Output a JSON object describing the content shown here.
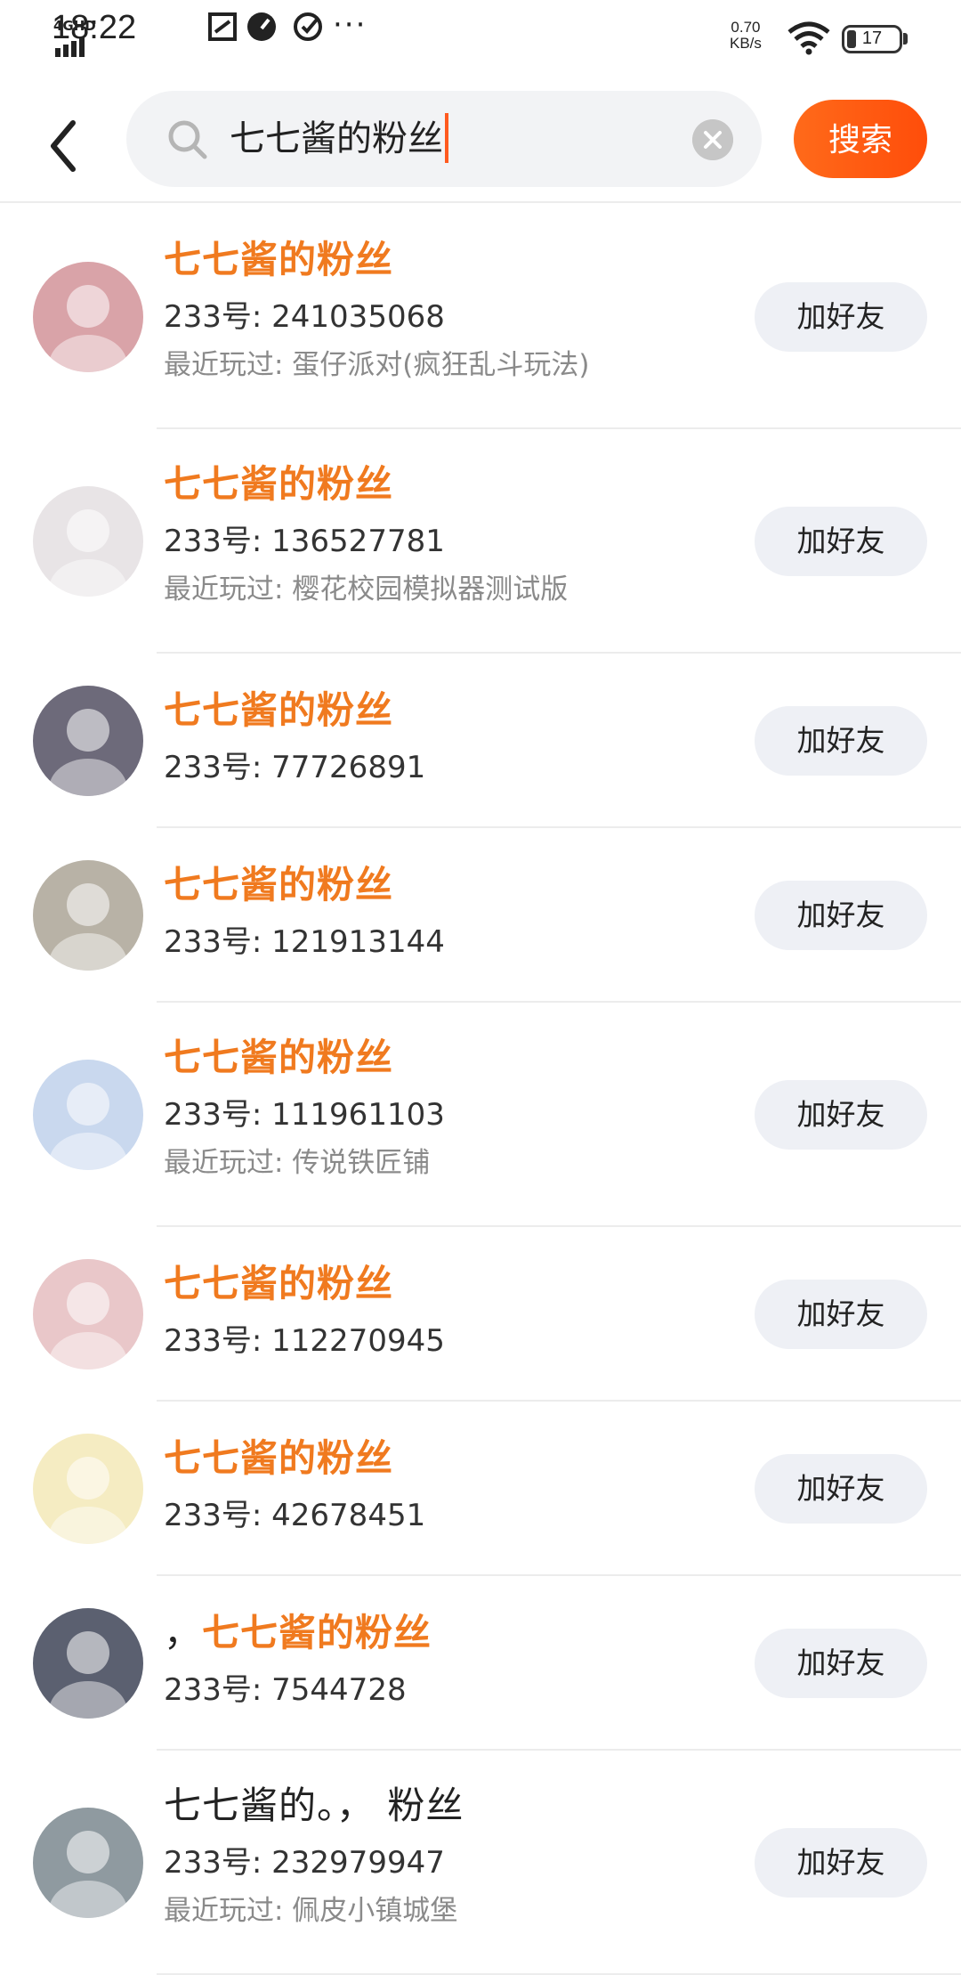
{
  "status_bar": {
    "network": "4GHD",
    "time": "18:22",
    "speed_value": "0.70",
    "speed_unit": "KB/s",
    "battery": "17",
    "battery_level": 0.17
  },
  "header": {
    "search_value": "七七酱的粉丝",
    "search_button": "搜索"
  },
  "results": [
    {
      "name_prefix": "",
      "name": "七七酱的粉丝",
      "uid": "233号: 241035068",
      "recent": "最近玩过: 蛋仔派对(疯狂乱斗玩法)",
      "button": "加好友",
      "avatar_color": "#d9a3a8"
    },
    {
      "name_prefix": "",
      "name": "七七酱的粉丝",
      "uid": "233号: 136527781",
      "recent": "最近玩过: 樱花校园模拟器测试版",
      "button": "加好友",
      "avatar_color": "#e8e4e6"
    },
    {
      "name_prefix": "",
      "name": "七七酱的粉丝",
      "uid": "233号: 77726891",
      "recent": "",
      "button": "加好友",
      "avatar_color": "#6d6a7a"
    },
    {
      "name_prefix": "",
      "name": "七七酱的粉丝",
      "uid": "233号: 121913144",
      "recent": "",
      "button": "加好友",
      "avatar_color": "#b8b2a6"
    },
    {
      "name_prefix": "",
      "name": "七七酱的粉丝",
      "uid": "233号: 111961103",
      "recent": "最近玩过: 传说铁匠铺",
      "button": "加好友",
      "avatar_color": "#c9d8ee"
    },
    {
      "name_prefix": "",
      "name": "七七酱的粉丝",
      "uid": "233号: 112270945",
      "recent": "",
      "button": "加好友",
      "avatar_color": "#e9c7c9"
    },
    {
      "name_prefix": "",
      "name": "七七酱的粉丝",
      "uid": "233号: 42678451",
      "recent": "",
      "button": "加好友",
      "avatar_color": "#f5ecc2"
    },
    {
      "name_prefix": "，",
      "name": "七七酱的粉丝",
      "uid": "233号: 7544728",
      "recent": "",
      "button": "加好友",
      "avatar_color": "#5b6070"
    },
    {
      "name_prefix": "七七酱的。， 粉丝",
      "name": "",
      "uid": "233号: 232979947",
      "recent": "最近玩过: 佩皮小镇城堡",
      "button": "加好友",
      "avatar_color": "#8f9aa0"
    }
  ]
}
